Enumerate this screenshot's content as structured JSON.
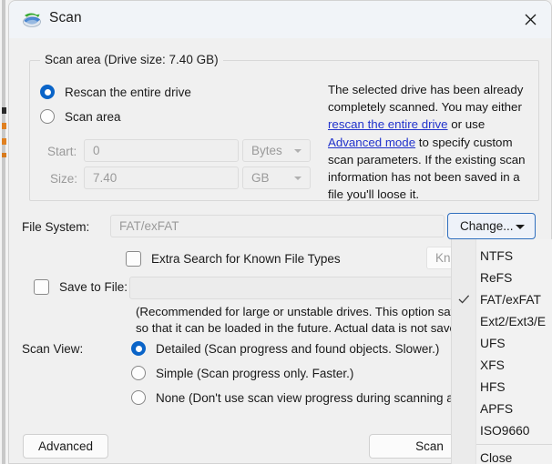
{
  "window": {
    "title": "Scan",
    "icon": "drive-scan-icon",
    "close_label": "Close window"
  },
  "scan_area_group": {
    "legend": "Scan area (Drive size: 7.40 GB)",
    "radios": [
      {
        "label": "Rescan the entire drive",
        "checked": true
      },
      {
        "label": "Scan area",
        "checked": false
      }
    ],
    "start": {
      "label": "Start:",
      "value": "0",
      "unit": "Bytes",
      "disabled": true
    },
    "size": {
      "label": "Size:",
      "value": "7.40",
      "unit": "GB",
      "disabled": true
    }
  },
  "info": {
    "part1": "The selected drive has been already completely scanned. You may either ",
    "link1": "rescan the entire drive",
    "part2": " or use ",
    "link2": "Advanced mode",
    "part3": " to specify custom scan parameters. If the existing scan information has not been saved in a file you'll loose it."
  },
  "file_system": {
    "label": "File System:",
    "value": "FAT/exFAT",
    "change_button": "Change...",
    "disabled": true
  },
  "extra_search": {
    "label": "Extra Search for Known File Types",
    "checked": false,
    "field_value": "Known"
  },
  "save_to_file": {
    "label": "Save to File:",
    "checked": false,
    "field_value": "",
    "note_line1": "(Recommended for large or unstable drives. This option saves",
    "note_line2": "so that it can be loaded in the future. Actual data is not saved!"
  },
  "scan_view": {
    "label": "Scan View:",
    "options": [
      {
        "label": "Detailed (Scan progress and found objects. Slower.)",
        "checked": true
      },
      {
        "label": "Simple (Scan progress only. Faster.)",
        "checked": false
      },
      {
        "label": "None (Don't use scan view progress during scanning at all",
        "checked": false
      }
    ]
  },
  "footer": {
    "advanced_button": "Advanced",
    "scan_button": "Scan"
  },
  "dropdown": {
    "items": [
      {
        "label": "NTFS",
        "checked": false
      },
      {
        "label": "ReFS",
        "checked": false
      },
      {
        "label": "FAT/exFAT",
        "checked": true
      },
      {
        "label": "Ext2/Ext3/E",
        "checked": false
      },
      {
        "label": "UFS",
        "checked": false
      },
      {
        "label": "XFS",
        "checked": false
      },
      {
        "label": "HFS",
        "checked": false
      },
      {
        "label": "APFS",
        "checked": false
      },
      {
        "label": "ISO9660",
        "checked": false
      }
    ],
    "close_item": "Close"
  },
  "colors": {
    "accent": "#0a64c8",
    "link": "#2233cc",
    "focus_border": "#2f6fbe",
    "window_bg": "#f0f0f0",
    "titlebar_bg": "#f1f4f8"
  }
}
